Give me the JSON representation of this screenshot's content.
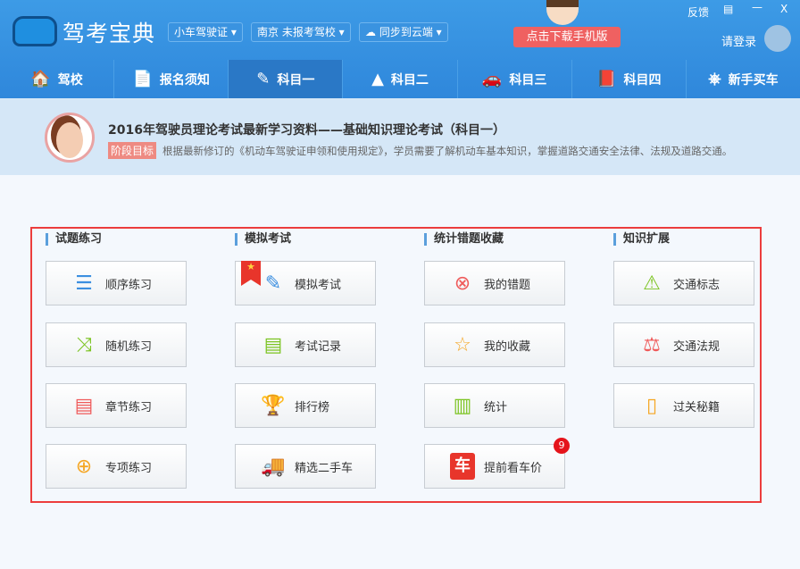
{
  "header": {
    "title": "驾考宝典",
    "license": "小车驾驶证",
    "school": "南京 未报考驾校",
    "sync": "同步到云端",
    "download": "点击下载手机版",
    "feedback": "反馈",
    "login": "请登录"
  },
  "nav": [
    {
      "label": "驾校",
      "icon": "🏠"
    },
    {
      "label": "报名须知",
      "icon": "📄"
    },
    {
      "label": "科目一",
      "icon": "✎"
    },
    {
      "label": "科目二",
      "icon": "▲"
    },
    {
      "label": "科目三",
      "icon": "🚗"
    },
    {
      "label": "科目四",
      "icon": "📕"
    },
    {
      "label": "新手买车",
      "icon": "⎈"
    }
  ],
  "banner": {
    "title": "2016年驾驶员理论考试最新学习资料——基础知识理论考试（科目一）",
    "tag": "阶段目标",
    "desc": "根据最新修订的《机动车驾驶证申领和使用规定》，学员需要了解机动车基本知识，掌握道路交通安全法律、法规及道路交通。"
  },
  "sections": [
    {
      "title": "试题练习",
      "items": [
        {
          "label": "顺序练习",
          "icon": "☰",
          "color": "#3c8fe0"
        },
        {
          "label": "随机练习",
          "icon": "⤨",
          "color": "#7cc423"
        },
        {
          "label": "章节练习",
          "icon": "▤",
          "color": "#ef5a5a"
        },
        {
          "label": "专项练习",
          "icon": "⊕",
          "color": "#f5a623"
        }
      ]
    },
    {
      "title": "模拟考试",
      "items": [
        {
          "label": "模拟考试",
          "icon": "✎",
          "color": "#3c8fe0"
        },
        {
          "label": "考试记录",
          "icon": "▤",
          "color": "#7cc423"
        },
        {
          "label": "排行榜",
          "icon": "🏆",
          "color": "#ef5a5a"
        },
        {
          "label": "精选二手车",
          "icon": "🚚",
          "color": "#7cc423"
        }
      ]
    },
    {
      "title": "统计错题收藏",
      "items": [
        {
          "label": "我的错题",
          "icon": "⊗",
          "color": "#ef5a5a"
        },
        {
          "label": "我的收藏",
          "icon": "☆",
          "color": "#f5a623"
        },
        {
          "label": "统计",
          "icon": "▥",
          "color": "#7cc423"
        },
        {
          "label": "提前看车价",
          "icon": "车",
          "color": "#e8352b",
          "badge": "9"
        }
      ]
    },
    {
      "title": "知识扩展",
      "items": [
        {
          "label": "交通标志",
          "icon": "⚠",
          "color": "#7cc423"
        },
        {
          "label": "交通法规",
          "icon": "⚖",
          "color": "#ef5a5a"
        },
        {
          "label": "过关秘籍",
          "icon": "▯",
          "color": "#f5a623"
        }
      ]
    }
  ]
}
